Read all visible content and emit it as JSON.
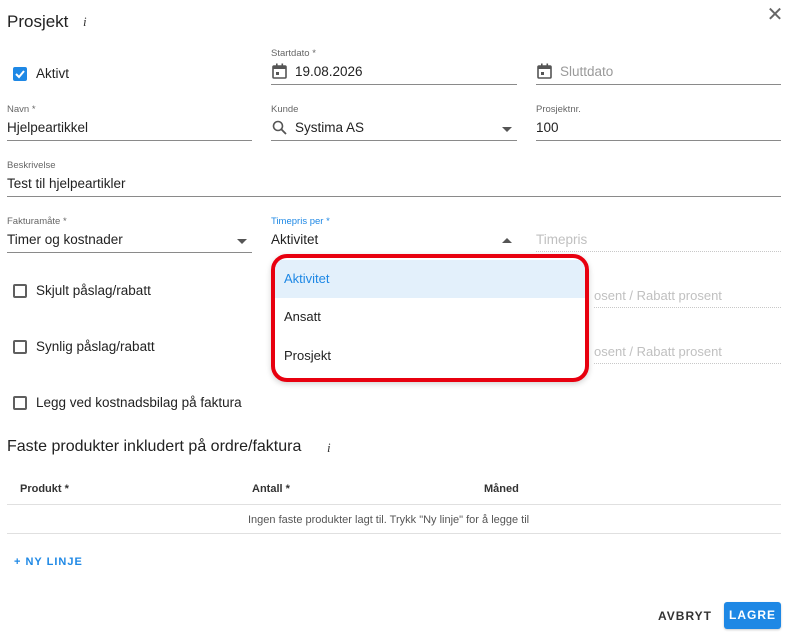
{
  "dialog": {
    "title": "Prosjekt",
    "info_glyph": "i",
    "close_glyph": "✕"
  },
  "active": {
    "label": "Aktivt",
    "checked": true
  },
  "start_date": {
    "label": "Startdato *",
    "value": "19.08.2026"
  },
  "end_date": {
    "placeholder": "Sluttdato"
  },
  "name": {
    "label": "Navn *",
    "value": "Hjelpeartikkel"
  },
  "customer": {
    "label": "Kunde",
    "value": "Systima AS"
  },
  "project_nr": {
    "label": "Prosjektnr.",
    "value": "100"
  },
  "description": {
    "label": "Beskrivelse",
    "value": "Test til hjelpeartikler"
  },
  "billing": {
    "label": "Fakturamåte *",
    "value": "Timer og kostnader"
  },
  "hourly_rate_per": {
    "label": "Timepris per *",
    "value": "Aktivitet"
  },
  "hourly_rate": {
    "placeholder": "Timepris"
  },
  "dropdown": {
    "options": [
      "Aktivitet",
      "Ansatt",
      "Prosjekt"
    ],
    "selected_index": 0
  },
  "hidden_markup": {
    "label": "Skjult påslag/rabatt",
    "checked": false,
    "partial_placeholder": "osent / Rabatt prosent"
  },
  "visible_markup": {
    "label": "Synlig påslag/rabatt",
    "checked": false,
    "partial_placeholder": "osent / Rabatt prosent"
  },
  "attach_cost": {
    "label": "Legg ved kostnadsbilag på faktura",
    "checked": false
  },
  "fixed_products": {
    "title": "Faste produkter inkludert på ordre/faktura",
    "columns": [
      "Produkt *",
      "Antall *",
      "Måned"
    ],
    "empty_message": "Ingen faste produkter lagt til. Trykk \"Ny linje\" for å legge til",
    "add_line": "+ NY LINJE"
  },
  "footer": {
    "cancel": "AVBRYT",
    "save": "LAGRE"
  },
  "colors": {
    "accent": "#1e88e5",
    "highlight_border": "#e8000f"
  },
  "icons": [
    "info-icon",
    "close-icon",
    "calendar-icon",
    "search-icon",
    "chevron-down-icon",
    "chevron-up-icon",
    "checkbox-icon"
  ]
}
